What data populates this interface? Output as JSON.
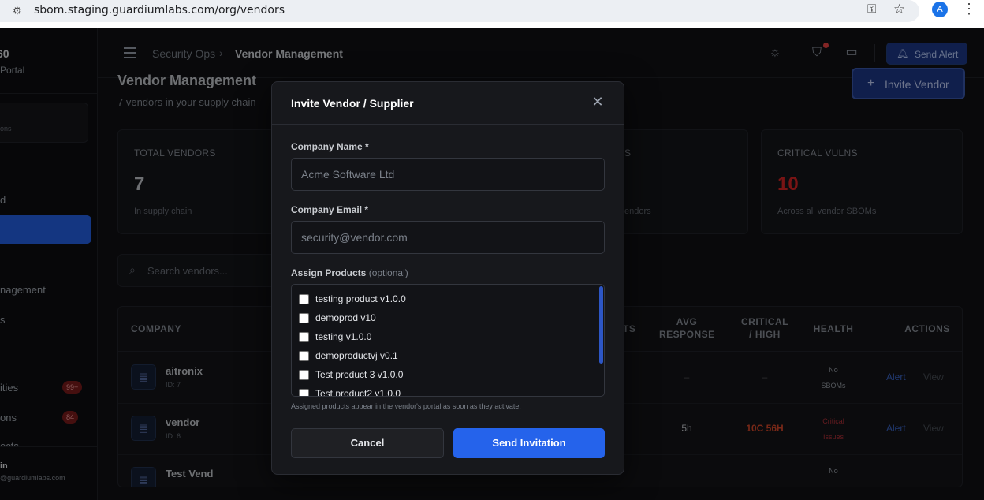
{
  "browser": {
    "url": "sbom.staging.guardiumlabs.com/org/vendors",
    "profile_initial": "A"
  },
  "sidebar": {
    "logo_title": "60",
    "logo_sub": "Portal",
    "box_text": "ons",
    "items": [
      {
        "label": "d"
      },
      {
        "label": "nagement"
      },
      {
        "label": "s"
      },
      {
        "label": "ities",
        "badge": "99+"
      },
      {
        "label": "ons",
        "badge": "84"
      },
      {
        "label": "ects"
      }
    ],
    "user_name": "in",
    "user_email": "@guardiumlabs.com"
  },
  "topbar": {
    "breadcrumb_parent": "Security Ops",
    "breadcrumb_sep": "›",
    "breadcrumb_current": "Vendor Management",
    "send_alert_label": "Send Alert"
  },
  "page": {
    "title": "Vendor Management",
    "subtitle": "7 vendors in your supply chain",
    "invite_label": "Invite Vendor"
  },
  "cards": [
    {
      "label": "TOTAL VENDORS",
      "value": "7",
      "sub": "In supply chain",
      "color": "#c9ccd1"
    },
    {
      "label": "S",
      "value": "",
      "sub": "endors",
      "color": "#c9ccd1"
    },
    {
      "label": "CRITICAL VULNS",
      "value": "10",
      "sub": "Across all vendor SBOMs",
      "color": "#dc2626"
    }
  ],
  "search": {
    "placeholder": "Search vendors..."
  },
  "table": {
    "headers": {
      "company": "COMPANY",
      "products": "TS",
      "avg_response_1": "AVG",
      "avg_response_2": "RESPONSE",
      "critical_1": "CRITICAL",
      "critical_2": "/ HIGH",
      "health": "HEALTH",
      "actions": "ACTIONS"
    },
    "rows": [
      {
        "name": "aitronix",
        "id": "ID: 7",
        "avg": "–",
        "crit": "–",
        "health_1": "No",
        "health_2": "SBOMs",
        "alert": "Alert",
        "view": "View"
      },
      {
        "name": "vendor",
        "id": "ID: 6",
        "avg": "5h",
        "crit": "10C 56H",
        "health_1": "Critical",
        "health_2": "Issues",
        "alert": "Alert",
        "view": "View"
      },
      {
        "name": "Test Vend",
        "id": "",
        "avg": "",
        "crit": "",
        "health_1": "No",
        "health_2": "",
        "alert": "",
        "view": ""
      }
    ]
  },
  "modal": {
    "title": "Invite Vendor / Supplier",
    "company_name_label": "Company Name *",
    "company_name_placeholder": "Acme Software Ltd",
    "company_email_label": "Company Email *",
    "company_email_placeholder": "security@vendor.com",
    "assign_label": "Assign Products",
    "assign_optional": "(optional)",
    "products": [
      "testing product v1.0.0",
      "demoprod v10",
      "testing v1.0.0",
      "demoproductvj v0.1",
      "Test product 3 v1.0.0",
      "Test product2 v1.0.0"
    ],
    "hint": "Assigned products appear in the vendor's portal as soon as they activate.",
    "cancel_label": "Cancel",
    "send_label": "Send Invitation"
  }
}
